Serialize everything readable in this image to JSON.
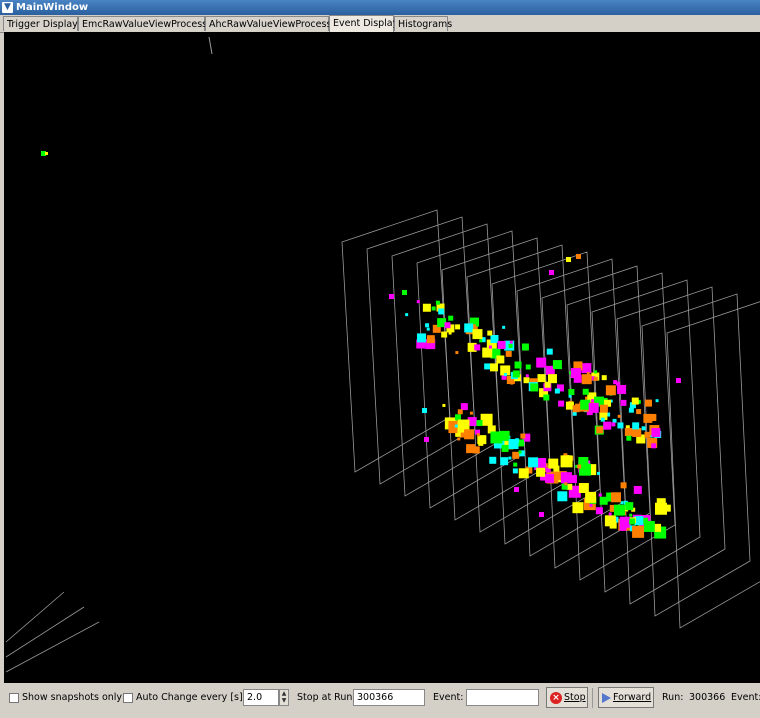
{
  "window": {
    "title": "MainWindow"
  },
  "tabs": [
    {
      "label": "Trigger Display"
    },
    {
      "label": "EmcRawValueViewProcessor"
    },
    {
      "label": "AhcRawValueViewProcessor"
    },
    {
      "label": "Event Display"
    },
    {
      "label": "Histograms"
    }
  ],
  "active_tab": "Event Display",
  "controls": {
    "show_snapshots_label": "Show snapshots only",
    "show_snapshots_checked": false,
    "auto_change_label": "Auto Change every [s]:",
    "auto_change_checked": false,
    "auto_change_value": "2.0",
    "stop_at_run_label": "Stop at Run:",
    "stop_at_run_value": "300366",
    "event_label": "Event:",
    "event_value": "",
    "stop_button": "Stop",
    "forward_button": "Forward",
    "run_label": "Run:",
    "run_value": "300366",
    "event_status_label": "Event:"
  },
  "colors": {
    "hit_colors": [
      "#ff00ff",
      "#00ffff",
      "#ffff00",
      "#00ff00",
      "#ff7f00",
      "#0000ff",
      "#ffffff"
    ],
    "plane_outline": "#9a9a9a",
    "background": "#000000"
  }
}
